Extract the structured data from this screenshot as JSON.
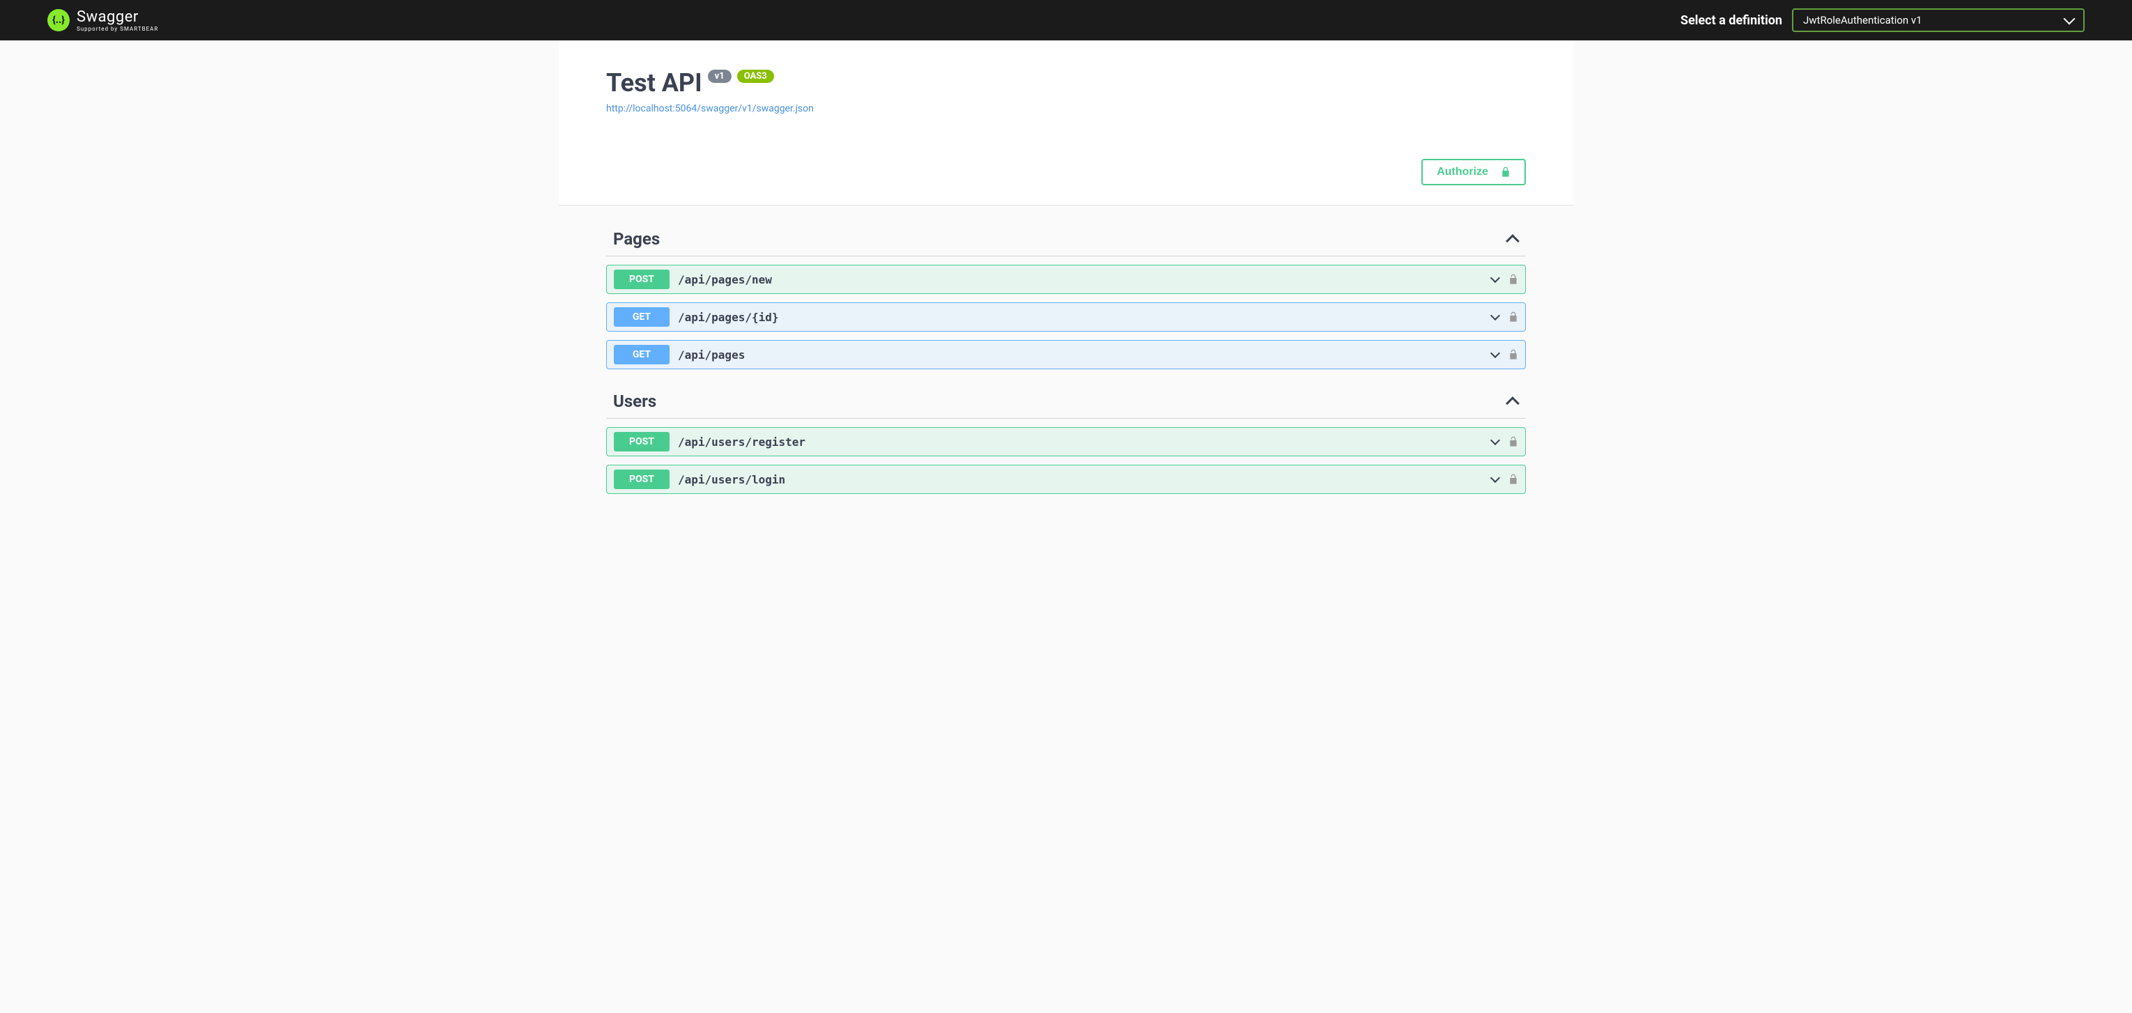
{
  "topbar": {
    "logo_main": "Swagger",
    "logo_sub": "Supported by SMARTBEAR",
    "select_label": "Select a definition",
    "selected_definition": "JwtRoleAuthentication v1"
  },
  "info": {
    "title": "Test API",
    "version_badge": "v1",
    "oas_badge": "OAS3",
    "spec_url": "http://localhost:5064/swagger/v1/swagger.json"
  },
  "auth": {
    "authorize_label": "Authorize"
  },
  "tags": [
    {
      "name": "Pages",
      "expanded": true,
      "operations": [
        {
          "method": "POST",
          "path": "/api/pages/new",
          "locked": true
        },
        {
          "method": "GET",
          "path": "/api/pages/{id}",
          "locked": true
        },
        {
          "method": "GET",
          "path": "/api/pages",
          "locked": true
        }
      ]
    },
    {
      "name": "Users",
      "expanded": true,
      "operations": [
        {
          "method": "POST",
          "path": "/api/users/register",
          "locked": true
        },
        {
          "method": "POST",
          "path": "/api/users/login",
          "locked": true
        }
      ]
    }
  ]
}
